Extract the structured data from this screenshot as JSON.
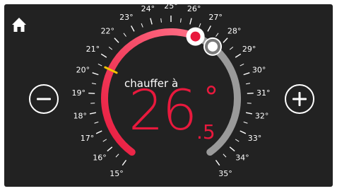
{
  "header": {
    "home_icon": "home-icon"
  },
  "controls": {
    "decrease_icon": "minus-icon",
    "increase_icon": "plus-icon"
  },
  "thermostat": {
    "mode_label": "chauffer à",
    "setpoint_integer": "26",
    "setpoint_decimal": ".5",
    "degree_symbol": "°",
    "setpoint_value": 26.5,
    "current_value": 27.7,
    "comfort_marker_value": 20.5,
    "scale_min": 15,
    "scale_max": 35,
    "scale_labels": [
      "15°",
      "16°",
      "17°",
      "18°",
      "19°",
      "20°",
      "21°",
      "22°",
      "23°",
      "24°",
      "25°",
      "26°",
      "27°",
      "28°",
      "29°",
      "30°",
      "31°",
      "32°",
      "33°",
      "34°",
      "35°"
    ]
  },
  "colors": {
    "background": "#222222",
    "active_arc_start": "#e8193d",
    "active_arc_end": "#ff6f86",
    "inactive_arc": "#9a9a9a",
    "setpoint_text": "#e8193d",
    "marker": "#f2c200",
    "text": "#ffffff"
  }
}
